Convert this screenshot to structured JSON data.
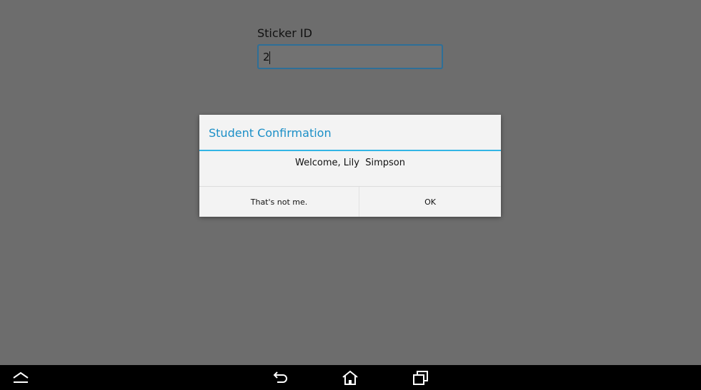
{
  "form": {
    "field_label": "Sticker ID",
    "field_value": "2"
  },
  "dialog": {
    "title": "Student Confirmation",
    "message": "Welcome, Lily  Simpson",
    "negative_button": "That's not me.",
    "positive_button": "OK"
  },
  "navbar": {
    "icons": [
      "menu-up-icon",
      "back-icon",
      "home-icon",
      "recent-apps-icon"
    ],
    "color": "#ffffff"
  },
  "colors": {
    "accent": "#33b5e5",
    "title": "#1b8fc7",
    "dim_overlay": "#6d6d6d"
  }
}
